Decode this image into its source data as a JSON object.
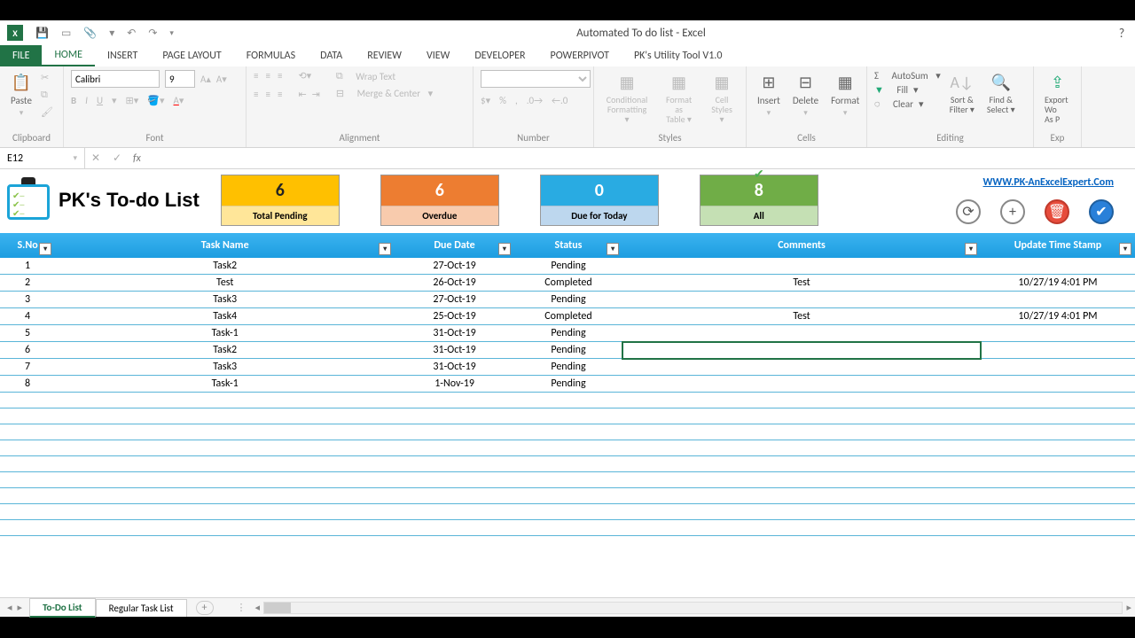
{
  "titlebar": {
    "title": "Automated To do list - Excel"
  },
  "tabs": {
    "file": "FILE",
    "items": [
      "HOME",
      "INSERT",
      "PAGE LAYOUT",
      "FORMULAS",
      "DATA",
      "REVIEW",
      "VIEW",
      "DEVELOPER",
      "POWERPIVOT",
      "PK's Utility Tool V1.0"
    ],
    "active": "HOME"
  },
  "ribbon": {
    "clipboard": {
      "paste": "Paste",
      "title": "Clipboard"
    },
    "font": {
      "name": "Calibri",
      "size": "9",
      "title": "Font"
    },
    "alignment": {
      "wrap": "Wrap Text",
      "merge": "Merge & Center",
      "title": "Alignment"
    },
    "number": {
      "title": "Number"
    },
    "styles": {
      "cf": "Conditional Formatting",
      "fat": "Format as Table",
      "cs": "Cell Styles",
      "title": "Styles"
    },
    "cells": {
      "insert": "Insert",
      "delete": "Delete",
      "format": "Format",
      "title": "Cells"
    },
    "editing": {
      "autosum": "AutoSum",
      "fill": "Fill",
      "clear": "Clear",
      "sort": "Sort & Filter",
      "find": "Find & Select",
      "title": "Editing"
    },
    "export": {
      "label": "Export Wo As P",
      "title": "Exp"
    }
  },
  "formulabar": {
    "cell": "E12"
  },
  "dashboard": {
    "title": "PK's To-do List",
    "cards": [
      {
        "num": "6",
        "label": "Total Pending"
      },
      {
        "num": "6",
        "label": "Overdue"
      },
      {
        "num": "0",
        "label": "Due for Today"
      },
      {
        "num": "8",
        "label": "All"
      }
    ],
    "link": "WWW.PK-AnExcelExpert.Com"
  },
  "table": {
    "headers": [
      "S.No",
      "Task Name",
      "Due Date",
      "Status",
      "Comments",
      "Update Time Stamp"
    ],
    "rows": [
      {
        "sno": "1",
        "task": "Task2",
        "due": "27-Oct-19",
        "status": "Pending",
        "comments": "",
        "ts": ""
      },
      {
        "sno": "2",
        "task": "Test",
        "due": "26-Oct-19",
        "status": "Completed",
        "comments": "Test",
        "ts": "10/27/19 4:01 PM"
      },
      {
        "sno": "3",
        "task": "Task3",
        "due": "27-Oct-19",
        "status": "Pending",
        "comments": "",
        "ts": ""
      },
      {
        "sno": "4",
        "task": "Task4",
        "due": "25-Oct-19",
        "status": "Completed",
        "comments": "Test",
        "ts": "10/27/19 4:01 PM"
      },
      {
        "sno": "5",
        "task": "Task-1",
        "due": "31-Oct-19",
        "status": "Pending",
        "comments": "",
        "ts": ""
      },
      {
        "sno": "6",
        "task": "Task2",
        "due": "31-Oct-19",
        "status": "Pending",
        "comments": "",
        "ts": ""
      },
      {
        "sno": "7",
        "task": "Task3",
        "due": "31-Oct-19",
        "status": "Pending",
        "comments": "",
        "ts": ""
      },
      {
        "sno": "8",
        "task": "Task-1",
        "due": "1-Nov-19",
        "status": "Pending",
        "comments": "",
        "ts": ""
      }
    ]
  },
  "sheets": {
    "tabs": [
      "To-Do List",
      "Regular Task List"
    ],
    "active": "To-Do List"
  }
}
